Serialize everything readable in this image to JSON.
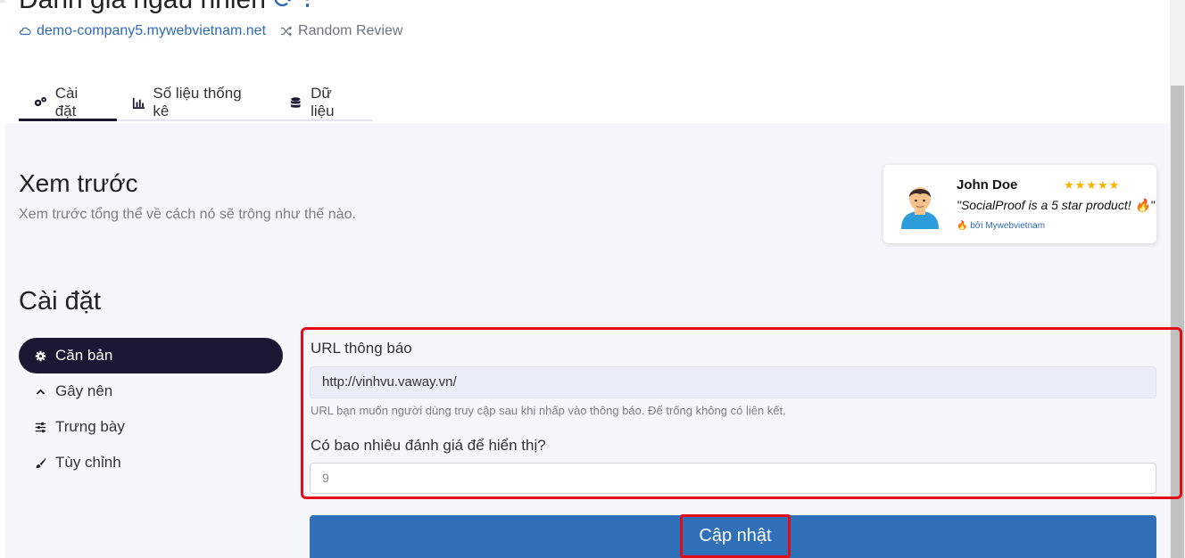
{
  "header": {
    "page_title": "Đánh giá ngẫu nhiên",
    "title_suffix": "⟳ ⁝",
    "site_link": "demo-company5.mywebvietnam.net",
    "review_type": "Random Review"
  },
  "tabs": [
    {
      "label": "Cài đặt",
      "icon": "gears-icon",
      "active": true
    },
    {
      "label": "Số liệu thống kê",
      "icon": "chart-icon",
      "active": false
    },
    {
      "label": "Dữ liệu",
      "icon": "database-icon",
      "active": false
    }
  ],
  "preview": {
    "title": "Xem trước",
    "subtitle": "Xem trước tổng thể về cách nó sẽ trông như thế nào."
  },
  "notification": {
    "name": "John Doe",
    "stars": "★★★★★",
    "text": "\"SocialProof is a 5 star product! 🔥\"",
    "by": "🔥 bởi Mywebvietnam"
  },
  "settings": {
    "title": "Cài đặt",
    "menu": [
      {
        "label": "Căn bản",
        "icon": "gear-icon",
        "active": true
      },
      {
        "label": "Gây nên",
        "icon": "chevron-up-icon",
        "active": false
      },
      {
        "label": "Trưng bày",
        "icon": "sliders-icon",
        "active": false
      },
      {
        "label": "Tùy chỉnh",
        "icon": "brush-icon",
        "active": false
      }
    ]
  },
  "form": {
    "url_label": "URL thông báo",
    "url_value": "http://vinhvu.vaway.vn/",
    "url_hint": "URL bạn muốn người dùng truy cập sau khi nhấp vào thông báo. Để trống không có liên kết.",
    "count_label": "Có bao nhiêu đánh giá để hiển thị?",
    "count_value": "9",
    "submit_label": "Cập nhật"
  },
  "colors": {
    "accent_dark": "#1c1733",
    "link_blue": "#2f6bb5",
    "button_blue": "#2f70b8",
    "highlight_red": "#e30b17",
    "star_gold": "#f4b400"
  }
}
